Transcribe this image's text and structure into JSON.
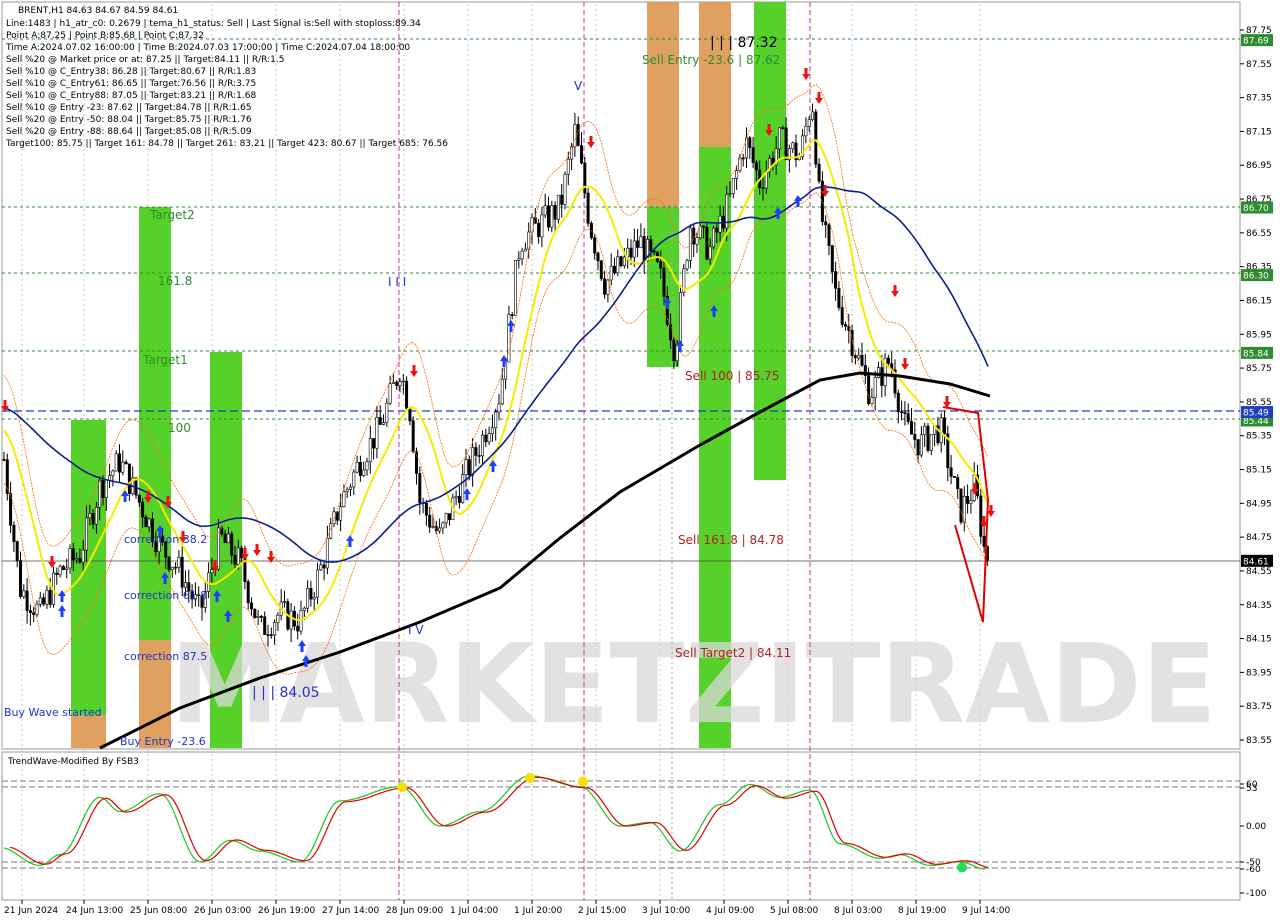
{
  "header": {
    "symbol_line": "BRENT,H1  84.63 84.67 84.59 84.61",
    "lines": [
      "Line:1483  | h1_atr_c0: 0.2679  | tema_h1_status: Sell  | Last Signal is:Sell with stoploss:89.34",
      "Point A:87.25  | Point B:85.68  | Point C:87.32",
      "Time A:2024.07.02 16:00:00  | Time B:2024.07.03 17:00:00  | Time C:2024.07.04 18:00:00",
      "Sell %20 @ Market price or at: 87.25  || Target:84.11  || R/R:1.5",
      "Sell %10 @ C_Entry38: 86.28  || Target:80.67  || R/R:1.83",
      "Sell %10 @ C_Entry61: 86.65  || Target:76.56  || R/R:3.75",
      "Sell %10 @ C_Entry88: 87.05  || Target:83.21  || R/R:1.68",
      "Sell %10 @ Entry -23: 87.62  || Target:84.78  || R/R:1.65",
      "Sell %20 @ Entry -50: 88.04  || Target:85.75  || R/R:1.76",
      "Sell %20 @ Entry -88: 88.64  || Target:85.08  || R/R:5.09",
      "Target100: 85.75  || Target 161: 84.78  || Target 261: 83.21  || Target 423: 80.67  || Target 685: 76.56"
    ]
  },
  "watermark": "MARKETZITRADE",
  "annotations": {
    "sell_entry": "Sell Entry -23.6 | 87.62",
    "point_c": "| | | 87.32",
    "target2": "Target2",
    "f1618": "161.8",
    "target1": "Target1",
    "f100": "100",
    "sell_100": "Sell 100 | 85.75",
    "sell_1618": "Sell 161.8 | 84.78",
    "sell_target2": "Sell Target2 | 84.11",
    "low_label": "| | | 84.05",
    "buy_wave": "Buy Wave started",
    "buy_entry": "Buy Entry -23.6",
    "corr382": "correction 38.2",
    "corr618": "correction 61.8",
    "corr875": "correction 87.5",
    "wave_v": "V",
    "wave_iii": "I I I",
    "wave_iv": "I V"
  },
  "price_axis": {
    "ticks": [
      "87.75",
      "87.55",
      "87.35",
      "87.15",
      "86.95",
      "86.75",
      "86.55",
      "86.35",
      "86.15",
      "85.95",
      "85.75",
      "85.55",
      "85.35",
      "85.15",
      "84.95",
      "84.75",
      "84.55",
      "84.35",
      "84.15",
      "83.95",
      "83.75",
      "83.55"
    ],
    "levels": [
      {
        "value": "87.69",
        "color": "#2e8b2e"
      },
      {
        "value": "86.70",
        "color": "#2e8b2e"
      },
      {
        "value": "86.30",
        "color": "#2e8b2e"
      },
      {
        "value": "85.84",
        "color": "#2e8b2e"
      },
      {
        "value": "85.44",
        "color": "#2e8b2e"
      },
      {
        "value": "85.49",
        "color": "#1f3fbf"
      },
      {
        "value": "84.61",
        "color": "#000000"
      }
    ]
  },
  "time_axis": [
    "21 Jun 2024",
    "24 Jun 13:00",
    "25 Jun 08:00",
    "26 Jun 03:00",
    "26 Jun 19:00",
    "27 Jun 14:00",
    "28 Jun 09:00",
    "1 Jul 04:00",
    "1 Jul 20:00",
    "2 Jul 15:00",
    "3 Jul 10:00",
    "4 Jul 09:00",
    "5 Jul 08:00",
    "8 Jul 03:00",
    "8 Jul 19:00",
    "9 Jul 14:00"
  ],
  "indicator": {
    "title": "TrendWave-Modified By FSB3",
    "ticks": [
      "60",
      "53",
      "0.00",
      "-50",
      "-60",
      "-100"
    ]
  },
  "chart_data": {
    "type": "candlestick",
    "symbol": "BRENT",
    "timeframe": "H1",
    "last": {
      "open": 84.63,
      "high": 84.67,
      "low": 84.59,
      "close": 84.61
    },
    "ylim": [
      83.5,
      87.85
    ],
    "close_path": [
      [
        0,
        85.4
      ],
      [
        20,
        84.45
      ],
      [
        40,
        84.3
      ],
      [
        60,
        84.55
      ],
      [
        80,
        84.65
      ],
      [
        100,
        85.05
      ],
      [
        120,
        85.2
      ],
      [
        140,
        84.95
      ],
      [
        160,
        84.7
      ],
      [
        180,
        84.55
      ],
      [
        200,
        84.3
      ],
      [
        220,
        84.75
      ],
      [
        240,
        84.6
      ],
      [
        260,
        84.2
      ],
      [
        280,
        84.3
      ],
      [
        300,
        84.25
      ],
      [
        320,
        84.55
      ],
      [
        340,
        84.95
      ],
      [
        360,
        85.2
      ],
      [
        380,
        85.4
      ],
      [
        400,
        85.75
      ],
      [
        410,
        85.5
      ],
      [
        420,
        84.95
      ],
      [
        440,
        84.75
      ],
      [
        460,
        85.05
      ],
      [
        480,
        85.3
      ],
      [
        500,
        85.6
      ],
      [
        510,
        86.05
      ],
      [
        520,
        86.5
      ],
      [
        540,
        86.6
      ],
      [
        560,
        86.7
      ],
      [
        575,
        87.15
      ],
      [
        590,
        86.6
      ],
      [
        605,
        86.25
      ],
      [
        620,
        86.35
      ],
      [
        640,
        86.5
      ],
      [
        660,
        86.3
      ],
      [
        675,
        85.85
      ],
      [
        690,
        86.6
      ],
      [
        710,
        86.45
      ],
      [
        730,
        86.75
      ],
      [
        745,
        87.1
      ],
      [
        760,
        86.85
      ],
      [
        780,
        87.1
      ],
      [
        800,
        87.0
      ],
      [
        812,
        87.35
      ],
      [
        820,
        86.7
      ],
      [
        835,
        86.2
      ],
      [
        850,
        85.95
      ],
      [
        870,
        85.6
      ],
      [
        890,
        85.8
      ],
      [
        905,
        85.4
      ],
      [
        920,
        85.3
      ],
      [
        940,
        85.4
      ],
      [
        960,
        84.9
      ],
      [
        975,
        85.05
      ],
      [
        985,
        84.65
      ],
      [
        992,
        84.61
      ]
    ],
    "overlays": [
      {
        "name": "TEMA",
        "color": "#ffff00"
      },
      {
        "name": "EMA50",
        "color": "#0a1f8f"
      },
      {
        "name": "EMA200",
        "color": "#000000"
      }
    ],
    "oscillator": {
      "ylim": [
        -100,
        100
      ],
      "fast": [
        [
          0,
          -30
        ],
        [
          40,
          -55
        ],
        [
          60,
          -40
        ],
        [
          100,
          40
        ],
        [
          120,
          20
        ],
        [
          160,
          45
        ],
        [
          200,
          -50
        ],
        [
          230,
          -20
        ],
        [
          260,
          -35
        ],
        [
          300,
          -50
        ],
        [
          340,
          35
        ],
        [
          400,
          55
        ],
        [
          440,
          0
        ],
        [
          480,
          20
        ],
        [
          530,
          70
        ],
        [
          580,
          55
        ],
        [
          620,
          0
        ],
        [
          650,
          5
        ],
        [
          680,
          -35
        ],
        [
          720,
          30
        ],
        [
          750,
          58
        ],
        [
          780,
          40
        ],
        [
          810,
          50
        ],
        [
          840,
          -25
        ],
        [
          880,
          -45
        ],
        [
          900,
          -40
        ],
        [
          930,
          -55
        ],
        [
          960,
          -50
        ],
        [
          985,
          -60
        ]
      ],
      "markers_yellow": [
        [
          402,
          57
        ],
        [
          530,
          70
        ],
        [
          583,
          65
        ]
      ],
      "markers_green": [
        [
          962,
          -55
        ]
      ]
    }
  }
}
